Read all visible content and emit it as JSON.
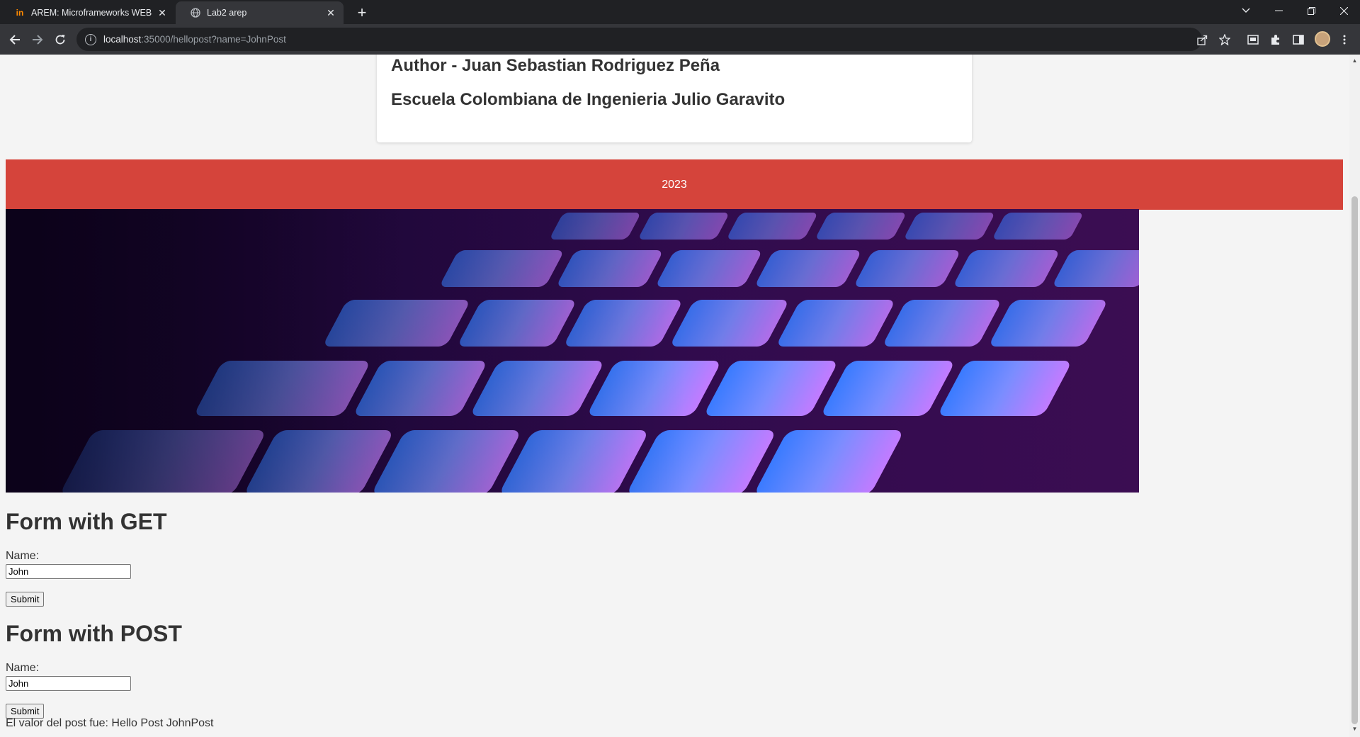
{
  "browser": {
    "tabs": [
      {
        "title": "AREM: Microframeworks WEB",
        "active": false,
        "favicon": "in-logo-icon"
      },
      {
        "title": "Lab2 arep",
        "active": true,
        "favicon": "globe-icon"
      }
    ],
    "url": {
      "host": "localhost",
      "rest": ":35000/hellopost?name=JohnPost"
    }
  },
  "page": {
    "card": {
      "author": "Author - Juan Sebastian Rodriguez Peña",
      "school": "Escuela Colombiana de Ingenieria Julio Garavito"
    },
    "footer": {
      "year": "2023",
      "color": "#d5443b"
    },
    "hero": {
      "alt": "keyboard-image"
    },
    "get_form": {
      "title": "Form with GET",
      "name_label": "Name:",
      "name_value": "John",
      "submit_label": "Submit"
    },
    "post_form": {
      "title": "Form with POST",
      "name_label": "Name:",
      "name_value": "John",
      "submit_label": "Submit",
      "result_text": "El valor del post fue: Hello Post JohnPost"
    }
  }
}
